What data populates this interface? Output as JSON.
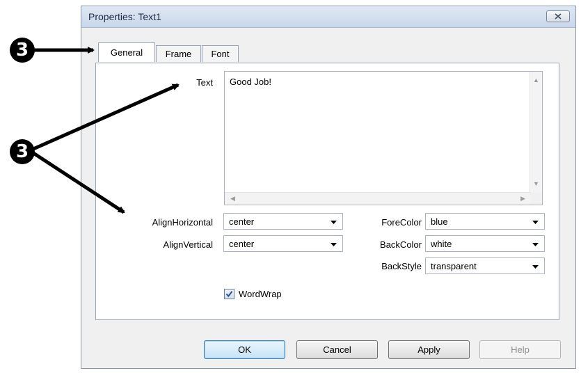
{
  "window": {
    "title": "Properties: Text1"
  },
  "tabs": [
    {
      "label": "General",
      "active": true
    },
    {
      "label": "Frame",
      "active": false
    },
    {
      "label": "Font",
      "active": false
    }
  ],
  "general": {
    "text_label": "Text",
    "text_value": "Good Job!",
    "align_horizontal_label": "AlignHorizontal",
    "align_horizontal_value": "center",
    "align_vertical_label": "AlignVertical",
    "align_vertical_value": "center",
    "fore_color_label": "ForeColor",
    "fore_color_value": "blue",
    "back_color_label": "BackColor",
    "back_color_value": "white",
    "back_style_label": "BackStyle",
    "back_style_value": "transparent",
    "word_wrap_label": "WordWrap",
    "word_wrap_checked": true
  },
  "buttons": {
    "ok": "OK",
    "cancel": "Cancel",
    "apply": "Apply",
    "help": "Help"
  },
  "callouts": {
    "marker_1": "3",
    "marker_2": "3"
  },
  "colors": {
    "callout": "#000000",
    "default_button_border": "#3c7fb1",
    "checkbox_check": "#2b4f8f"
  },
  "icons": {
    "close": "close-x-icon",
    "dropdown": "chevron-down-icon"
  }
}
